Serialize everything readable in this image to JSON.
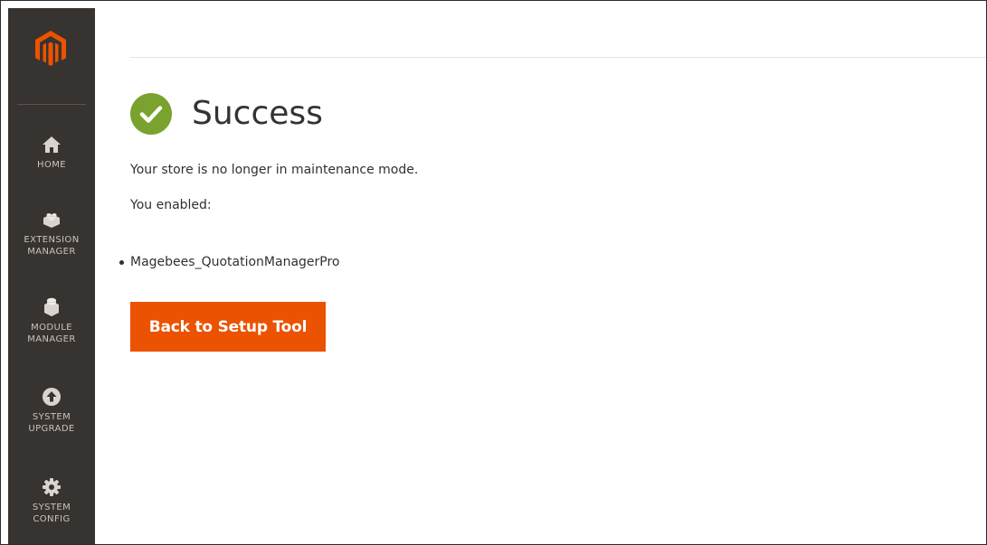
{
  "sidebar": {
    "logo": "magento-logo",
    "items": [
      {
        "label": "HOME",
        "icon": "home-icon"
      },
      {
        "label": "EXTENSION\nMANAGER",
        "icon": "lego-brick-icon"
      },
      {
        "label": "MODULE\nMANAGER",
        "icon": "cube-icon"
      },
      {
        "label": "SYSTEM\nUPGRADE",
        "icon": "upload-arrow-icon"
      },
      {
        "label": "SYSTEM\nCONFIG",
        "icon": "gear-icon"
      }
    ]
  },
  "main": {
    "title": "Success",
    "status_icon": "check-circle-icon",
    "maintenance_message": "Your store is no longer in maintenance mode.",
    "enabled_label": "You enabled:",
    "enabled_modules": [
      "Magebees_QuotationManagerPro"
    ],
    "back_button_label": "Back to Setup Tool"
  },
  "colors": {
    "sidebar_bg": "#373330",
    "sidebar_text": "#c8c3be",
    "brand_orange": "#eb5202",
    "success_green": "#79a22e",
    "text": "#303030"
  }
}
